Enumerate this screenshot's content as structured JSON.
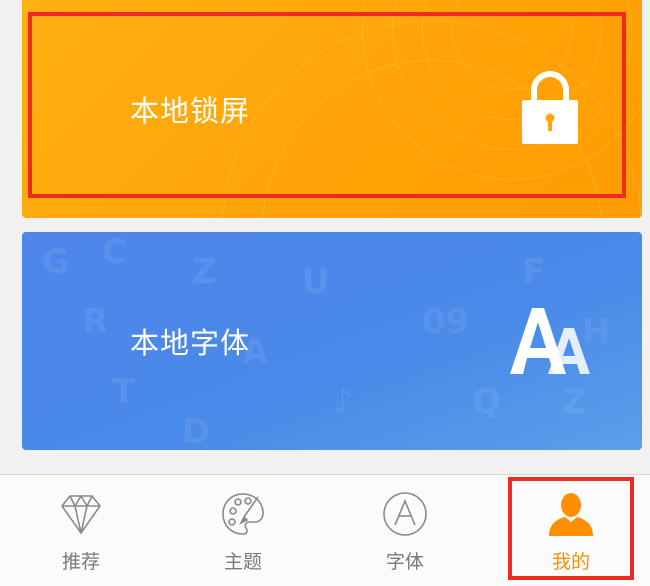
{
  "cards": {
    "lock": {
      "label": "本地锁屏",
      "icon": "lock-icon",
      "color": "#ffa80b"
    },
    "font": {
      "label": "本地字体",
      "icon": "font-aa-icon",
      "color": "#4a8ae8"
    }
  },
  "tabbar": {
    "items": [
      {
        "label": "推荐",
        "icon": "diamond-icon",
        "active": false
      },
      {
        "label": "主题",
        "icon": "palette-icon",
        "active": false
      },
      {
        "label": "字体",
        "icon": "font-a-icon",
        "active": false
      },
      {
        "label": "我的",
        "icon": "user-icon",
        "active": true
      }
    ],
    "active_color": "#ff8f00",
    "inactive_color": "#7a7a7a"
  },
  "highlight_color": "#ee2a22"
}
